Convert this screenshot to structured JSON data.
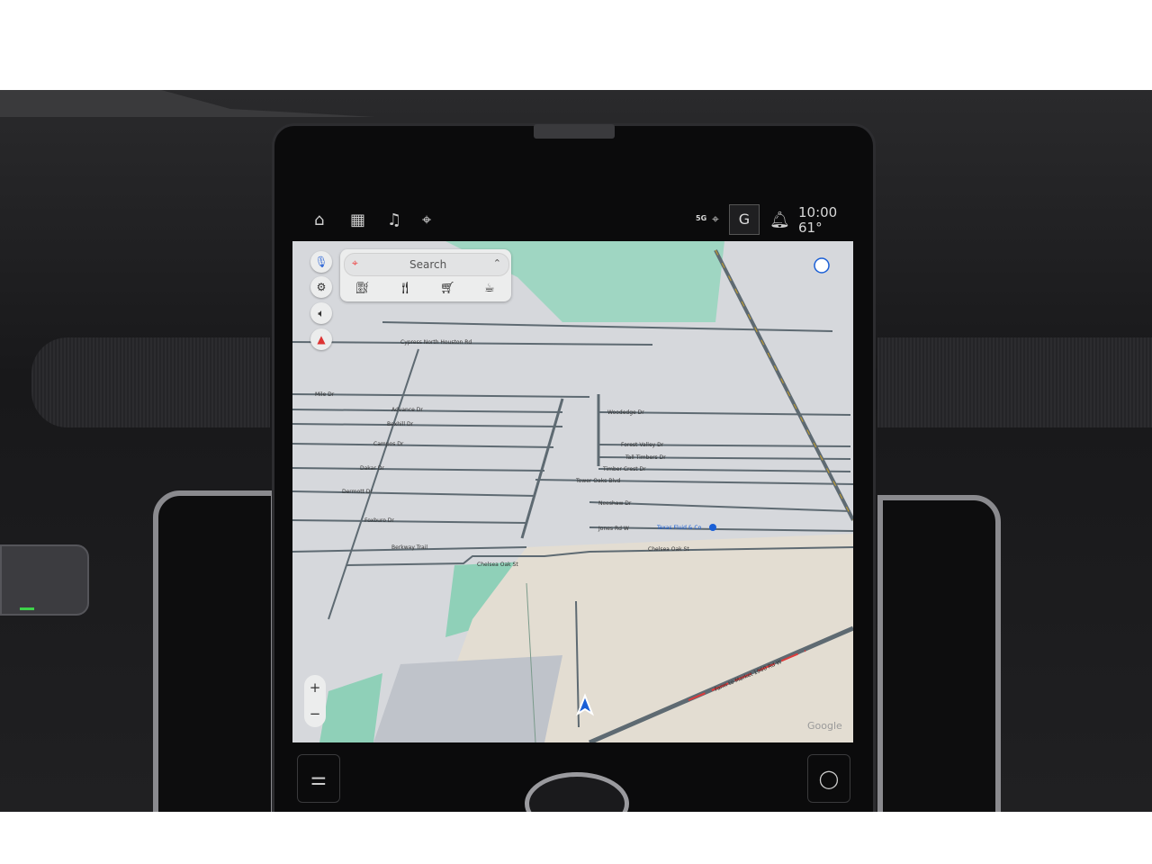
{
  "status_bar": {
    "nav_icons": [
      "home-icon",
      "apps-grid-icon",
      "music-icon",
      "location-pin-icon"
    ],
    "network": "5G",
    "profile_initial": "G",
    "time": "10:00",
    "temperature": "61°"
  },
  "search_panel": {
    "placeholder": "Search",
    "categories": [
      "gas-station-icon",
      "restaurant-icon",
      "grocery-icon",
      "coffee-icon"
    ]
  },
  "map_controls": [
    "microphone-icon",
    "settings-icon",
    "volume-icon",
    "compass-icon"
  ],
  "zoom": {
    "in": "+",
    "out": "−"
  },
  "map": {
    "streets": {
      "mile": "Mile Dr",
      "advance": "Advance Dr",
      "bexhill": "Bexhill Dr",
      "campos": "Campos Dr",
      "dakar": "Dakar Dr",
      "dermott": "Dermott Dr",
      "foxburo": "Foxburo Dr",
      "berkway": "Berkway Trail",
      "chelsea": "Chelsea Oak St",
      "woodedge": "Woodedge Dr",
      "forest": "Forest Valley Dr",
      "tall": "Tall Timbers Dr",
      "timber": "Timber Crest Dr",
      "tower": "Tower Oaks Blvd",
      "neeshaw": "Neeshaw Dr",
      "jones": "Jones Rd W",
      "cypress": "Cypress North Houston Rd",
      "fm": "Farm to Market 1960 Rd W"
    },
    "poi": "Texas Fluid & Co",
    "watermark": "Google",
    "colors": {
      "land": "#d6d8dc",
      "park": "#8fd0b8",
      "sand": "#e3ddd2",
      "road": "#5e6a72",
      "highway": "#c9a02a",
      "route": "#e03a3a",
      "poi": "#1a5fd6"
    }
  }
}
